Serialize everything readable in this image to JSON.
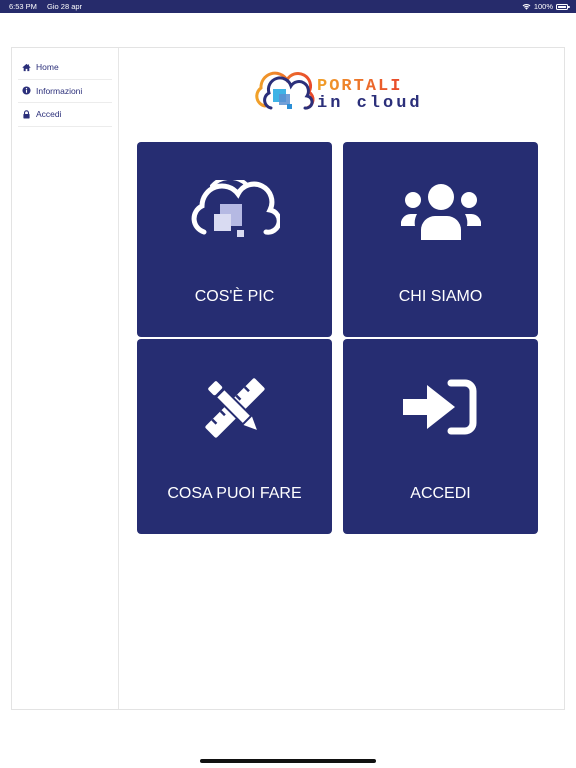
{
  "statusbar": {
    "time": "6:53 PM",
    "date": "Gio 28 apr",
    "battery": "100%"
  },
  "sidebar": {
    "items": [
      {
        "label": "Home",
        "icon": "home-icon"
      },
      {
        "label": "Informazioni",
        "icon": "info-icon"
      },
      {
        "label": "Accedi",
        "icon": "lock-icon"
      }
    ]
  },
  "logo": {
    "line1": "PORTALI",
    "line2": "in cloud"
  },
  "tiles": [
    {
      "label": "COS'È PIC",
      "icon": "cloud-icon"
    },
    {
      "label": "CHI SIAMO",
      "icon": "users-icon"
    },
    {
      "label": "COSA PUOI FARE",
      "icon": "pencil-ruler-icon"
    },
    {
      "label": "ACCEDI",
      "icon": "sign-in-icon"
    }
  ],
  "colors": {
    "primary": "#262d72",
    "statusbar": "#262b6b",
    "accent_orange": "#f1a22a",
    "accent_red": "#e8472b"
  }
}
